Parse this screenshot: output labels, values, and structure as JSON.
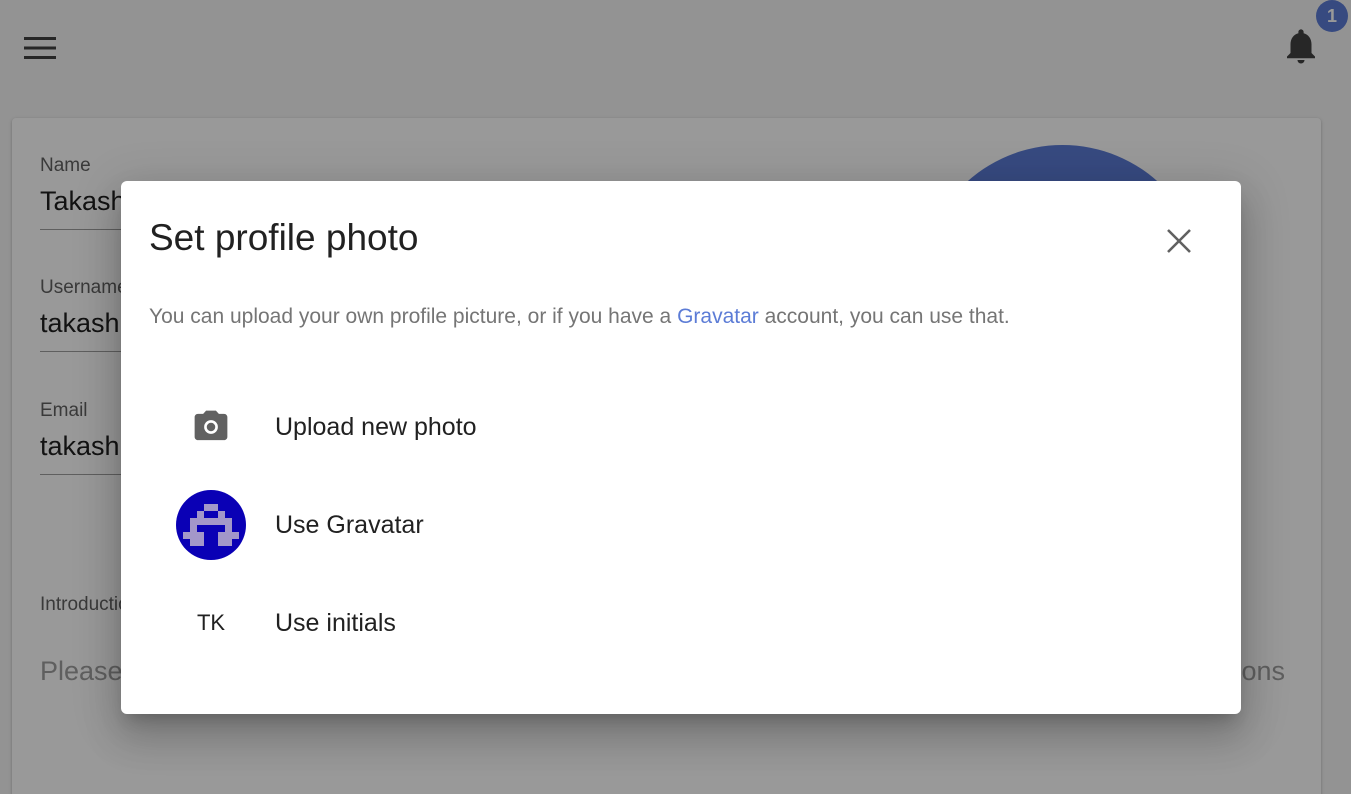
{
  "page": {
    "form": {
      "name_label": "Name",
      "name_value": "Takashi",
      "username_label": "Username",
      "username_value": "takashi",
      "email_label": "Email",
      "email_value": "takashi",
      "intro_label": "Introduction",
      "intro_placeholder": "Please",
      "intro_tail": "ations"
    },
    "notifications": {
      "badge_count": "1"
    }
  },
  "dialog": {
    "title": "Set profile photo",
    "description_before": "You can upload your own profile picture, or if you have a ",
    "description_link": "Gravatar",
    "description_after": " account, you can use that.",
    "options": [
      {
        "label": "Upload new photo",
        "icon": "camera-icon"
      },
      {
        "label": "Use Gravatar",
        "icon": "gravatar-avatar"
      },
      {
        "label": "Use initials",
        "icon": "initials-avatar",
        "initials": "TK"
      }
    ]
  },
  "colors": {
    "accent": "#5c7cd6",
    "gravatar_bg": "#0a00b5",
    "gravatar_fg": "#a397c9"
  }
}
